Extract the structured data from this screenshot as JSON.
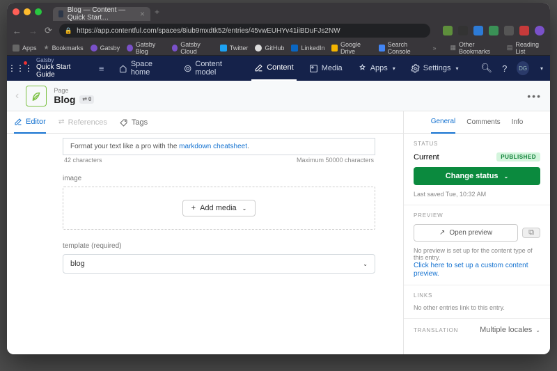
{
  "browser": {
    "tab_title": "Blog — Content — Quick Start…",
    "url": "https://app.contentful.com/spaces/8iub9mxdtk52/entries/45vwEUHYv41iiBDuFJs2NW",
    "bookmarks": [
      "Apps",
      "Bookmarks",
      "Gatsby",
      "Gatsby Blog",
      "Gatsby Cloud",
      "Twitter",
      "GitHub",
      "LinkedIn",
      "Google Drive",
      "Search Console"
    ],
    "bookmarks_right": [
      "Other Bookmarks",
      "Reading List"
    ]
  },
  "nav": {
    "space_small": "Gatsby",
    "space_name": "Quick Start Guide",
    "items": [
      "Space home",
      "Content model",
      "Content",
      "Media",
      "Apps",
      "Settings"
    ],
    "avatar": "DG"
  },
  "entry": {
    "type": "Page",
    "title": "Blog",
    "link_count": "0"
  },
  "main_tabs": {
    "editor": "Editor",
    "references": "References",
    "tags": "Tags"
  },
  "editor": {
    "hint_prefix": "Format your text like a pro with the ",
    "hint_link": "markdown cheatsheet",
    "hint_suffix": ".",
    "char_count": "42 characters",
    "char_max": "Maximum 50000 characters",
    "image_label": "image",
    "add_media": "Add media",
    "template_label": "template (required)",
    "template_value": "blog"
  },
  "side_tabs": {
    "general": "General",
    "comments": "Comments",
    "info": "Info"
  },
  "status": {
    "heading": "STATUS",
    "current_label": "Current",
    "published": "PUBLISHED",
    "change": "Change status",
    "last_saved": "Last saved Tue, 10:32 AM"
  },
  "preview": {
    "heading": "PREVIEW",
    "open": "Open preview",
    "none": "No preview is set up for the content type of this entry.",
    "link": "Click here to set up a custom content preview."
  },
  "links": {
    "heading": "LINKS",
    "none": "No other entries link to this entry."
  },
  "translation": {
    "heading": "TRANSLATION",
    "select": "Multiple locales"
  }
}
